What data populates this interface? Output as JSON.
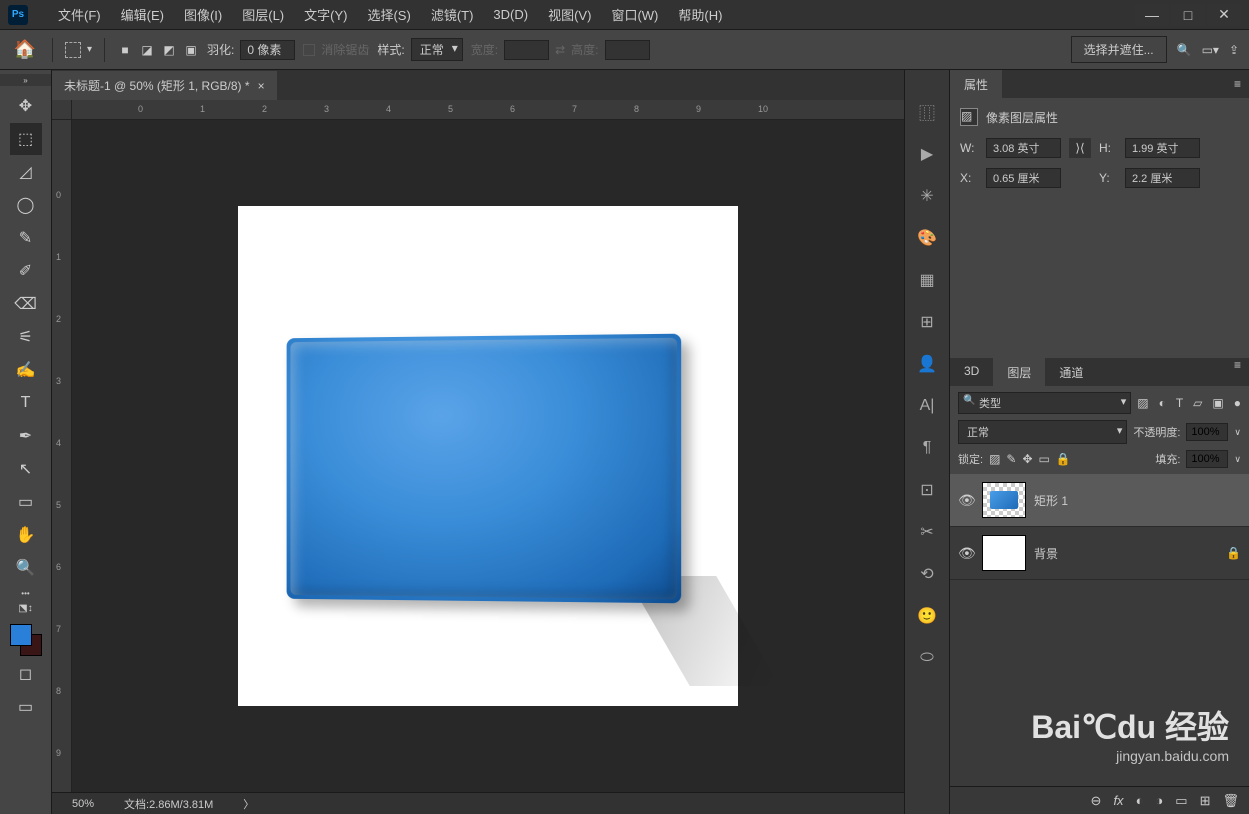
{
  "app": {
    "logo": "Ps"
  },
  "menu": [
    "文件(F)",
    "编辑(E)",
    "图像(I)",
    "图层(L)",
    "文字(Y)",
    "选择(S)",
    "滤镜(T)",
    "3D(D)",
    "视图(V)",
    "窗口(W)",
    "帮助(H)"
  ],
  "window_controls": {
    "min": "—",
    "max": "□",
    "close": "✕"
  },
  "options": {
    "feather_label": "羽化:",
    "feather_value": "0 像素",
    "antialias": "消除锯齿",
    "style_label": "样式:",
    "style_value": "正常",
    "width_label": "宽度:",
    "swap": "⇄",
    "height_label": "高度:",
    "mask_btn": "选择并遮住...",
    "share": "⇪"
  },
  "doc_tab": {
    "title": "未标题-1 @ 50% (矩形 1, RGB/8) *",
    "close": "×"
  },
  "ruler_h": [
    "0",
    "1",
    "2",
    "3",
    "4",
    "5",
    "6",
    "7",
    "8",
    "9",
    "10"
  ],
  "ruler_v": [
    "0",
    "1",
    "2",
    "3",
    "4",
    "5",
    "6",
    "7",
    "8",
    "9"
  ],
  "status": {
    "zoom": "50%",
    "doc": "文档:2.86M/3.81M",
    "arrow": "〉"
  },
  "right_tools": [
    "⿲",
    "▶",
    "✳",
    "🎨",
    "▦",
    "⊞",
    "👤",
    "A|",
    "¶",
    "⊡",
    "✂",
    "⟲",
    "🙂",
    "⬭"
  ],
  "properties": {
    "tab": "属性",
    "title": "像素图层属性",
    "w_label": "W:",
    "w_value": "3.08 英寸",
    "h_label": "H:",
    "h_value": "1.99 英寸",
    "x_label": "X:",
    "x_value": "0.65 厘米",
    "y_label": "Y:",
    "y_value": "2.2 厘米"
  },
  "layers_panel": {
    "tabs": [
      "3D",
      "图层",
      "通道"
    ],
    "filter": "类型",
    "blend_mode": "正常",
    "opacity_label": "不透明度:",
    "opacity_value": "100%",
    "lock_label": "锁定:",
    "fill_label": "填充:",
    "fill_value": "100%",
    "items": [
      {
        "name": "矩形 1",
        "locked": false
      },
      {
        "name": "背景",
        "locked": true
      }
    ],
    "footer_icons": [
      "⊖",
      "fx",
      "◐",
      "◑",
      "▭",
      "⊞",
      "🗑"
    ]
  },
  "watermark": {
    "main": "Bai℃du 经验",
    "sub": "jingyan.baidu.com"
  },
  "tools": [
    "✥",
    "⬚",
    "◿",
    "◯",
    "✎",
    "✐",
    "⌫",
    "⚟",
    "✍",
    "T",
    "✒",
    "↖",
    "▭",
    "✋",
    "🔍"
  ]
}
